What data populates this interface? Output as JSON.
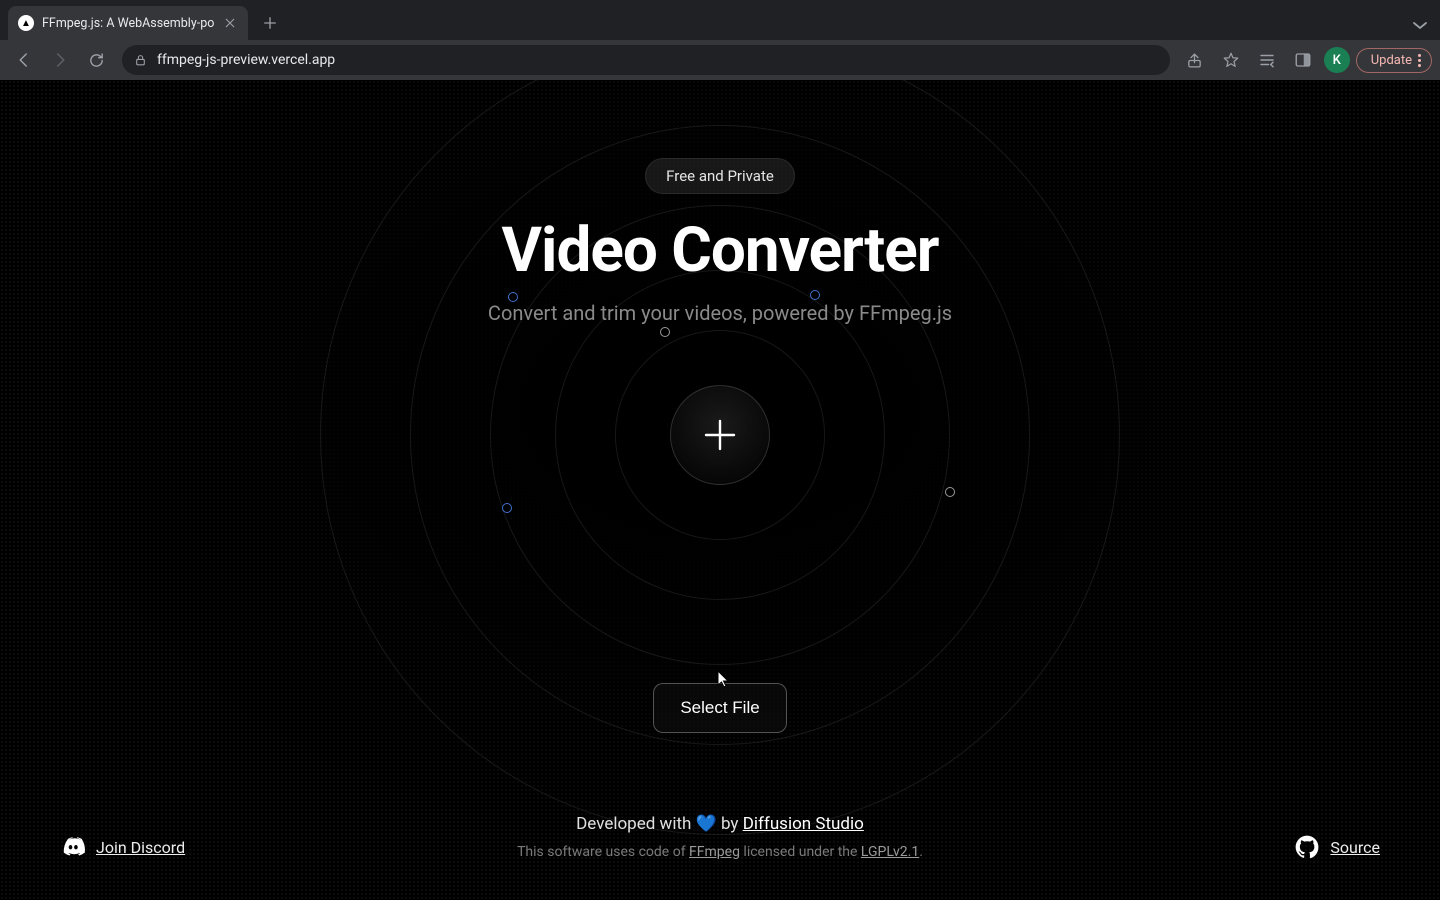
{
  "browser": {
    "tab_title": "FFmpeg.js: A WebAssembly-po",
    "url": "ffmpeg-js-preview.vercel.app",
    "avatar_initial": "K",
    "update_label": "Update"
  },
  "hero": {
    "badge": "Free and Private",
    "title": "Video Converter",
    "subtitle": "Convert and trim your videos, powered by FFmpeg.js",
    "select_file_label": "Select File"
  },
  "footer": {
    "developed_prefix": "Developed with ",
    "heart": "💙",
    "by": " by ",
    "studio": "Diffusion Studio",
    "license_prefix": "This software uses code of ",
    "ffmpeg": "FFmpeg",
    "license_mid": " licensed under the ",
    "license_name": "LGPLv2.1",
    "license_suffix": "."
  },
  "corners": {
    "discord": "Join Discord",
    "source": "Source"
  }
}
